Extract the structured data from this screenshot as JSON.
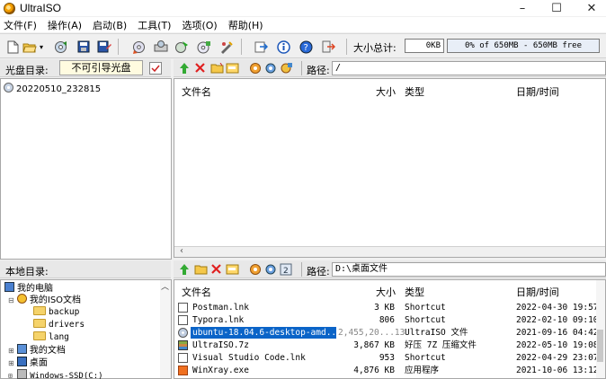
{
  "window": {
    "title": "UltraISO",
    "minimize": "–",
    "maximize": "☐",
    "close": "✕"
  },
  "menu": [
    "文件(F)",
    "操作(A)",
    "启动(B)",
    "工具(T)",
    "选项(O)",
    "帮助(H)"
  ],
  "toolbar": {
    "size_label": "大小总计:",
    "size_value": "0KB",
    "capacity_text": "0% of 650MB - 650MB free"
  },
  "image_panel": {
    "label": "光盘目录:",
    "boot_button": "不可引导光盘",
    "root_item": "20220510_232815",
    "path_label": "路径:",
    "path": "/",
    "columns": {
      "name": "文件名",
      "size": "大小",
      "type": "类型",
      "date": "日期/时间"
    }
  },
  "local_panel": {
    "label": "本地目录:",
    "path_label": "路径:",
    "path": "D:\\桌面文件",
    "tree": [
      {
        "label": "我的电脑",
        "level": 0
      },
      {
        "label": "我的ISO文档",
        "level": 1
      },
      {
        "label": "backup",
        "level": 2
      },
      {
        "label": "drivers",
        "level": 2
      },
      {
        "label": "lang",
        "level": 2
      },
      {
        "label": "我的文档",
        "level": 1
      },
      {
        "label": "桌面",
        "level": 1
      },
      {
        "label": "Windows-SSD(C:)",
        "level": 1
      }
    ],
    "columns": {
      "name": "文件名",
      "size": "大小",
      "type": "类型",
      "date": "日期/时间"
    },
    "files": [
      {
        "name": "Postman.lnk",
        "size": "3 KB",
        "type": "Shortcut",
        "date": "2022-04-30 19:57"
      },
      {
        "name": "Typora.lnk",
        "size": "806",
        "type": "Shortcut",
        "date": "2022-02-10 09:10"
      },
      {
        "name": "ubuntu-18.04.6-desktop-amd...",
        "size": "2,455,20...13",
        "type": "UltraISO 文件",
        "date": "2021-09-16 04:42",
        "selected": true
      },
      {
        "name": "UltraISO.7z",
        "size": "3,867 KB",
        "type": "好压 7Z 压缩文件",
        "date": "2022-05-10 19:08"
      },
      {
        "name": "Visual Studio Code.lnk",
        "size": "953",
        "type": "Shortcut",
        "date": "2022-04-29 23:07"
      },
      {
        "name": "WinXray.exe",
        "size": "4,876 KB",
        "type": "应用程序",
        "date": "2021-10-06 13:12"
      }
    ]
  },
  "colors": {
    "selection": "#0a64c8",
    "progress_fill": "#e8eef7"
  }
}
